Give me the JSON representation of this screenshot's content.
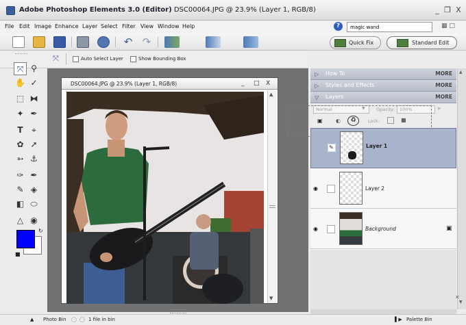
{
  "window": {
    "title": "Adobe Photoshop Elements 3.0 (Editor)",
    "doc_info": "DSC00064.JPG @ 23.9% (Layer 1, RGB/8)",
    "controls": [
      "_",
      "❐",
      "X"
    ]
  },
  "menu": {
    "items": [
      "File",
      "Edit",
      "Image",
      "Enhance",
      "Layer",
      "Select",
      "Filter",
      "View",
      "Window",
      "Help"
    ],
    "search_value": "magic wand"
  },
  "modes": {
    "quick_fix": "Quick Fix",
    "standard_edit": "Standard Edit"
  },
  "options": {
    "auto_select": "Auto Select Layer",
    "bounding_box": "Show Bounding Box"
  },
  "document": {
    "title": "DSC00064.JPG @ 23.9% (Layer 1, RGB/8)",
    "controls": [
      "_",
      "□",
      "X"
    ]
  },
  "palettes": [
    {
      "label": "How To",
      "more": "MORE"
    },
    {
      "label": "Styles and Effects",
      "more": "MORE"
    },
    {
      "label": "Layers",
      "more": "MORE"
    }
  ],
  "layers_panel": {
    "blend_mode": "Normal",
    "opacity_label": "Opacity:",
    "opacity_value": "100%",
    "lock_label": "Lock:",
    "layers": [
      {
        "name": "Layer 1",
        "selected": true,
        "visible": false
      },
      {
        "name": "Layer 2",
        "selected": false,
        "visible": true
      },
      {
        "name": "Background",
        "selected": false,
        "visible": true,
        "locked": true
      }
    ]
  },
  "bottom_bar": {
    "photo_bin": "Photo Bin",
    "files_in_bin": "1 file in bin",
    "palette_bin": "Palette Bin"
  },
  "colors": {
    "foreground": "#0000ff",
    "background": "#ffffff",
    "palette_header": "#b9bfcb",
    "workarea": "#707274"
  },
  "icons": [
    "move-tool-icon",
    "zoom-tool-icon",
    "hand-tool-icon",
    "eyedropper-icon",
    "marquee-icon",
    "lasso-icon",
    "magic-wand-icon",
    "selection-brush-icon",
    "type-tool-icon",
    "crop-icon",
    "cookie-cutter-icon",
    "straighten-icon",
    "red-eye-icon",
    "spot-healing-icon",
    "clone-stamp-icon",
    "brush-icon",
    "impressionist-brush-icon",
    "eraser-icon",
    "paint-bucket-icon",
    "gradient-icon",
    "shape-icon",
    "blur-icon",
    "sponge-icon"
  ]
}
